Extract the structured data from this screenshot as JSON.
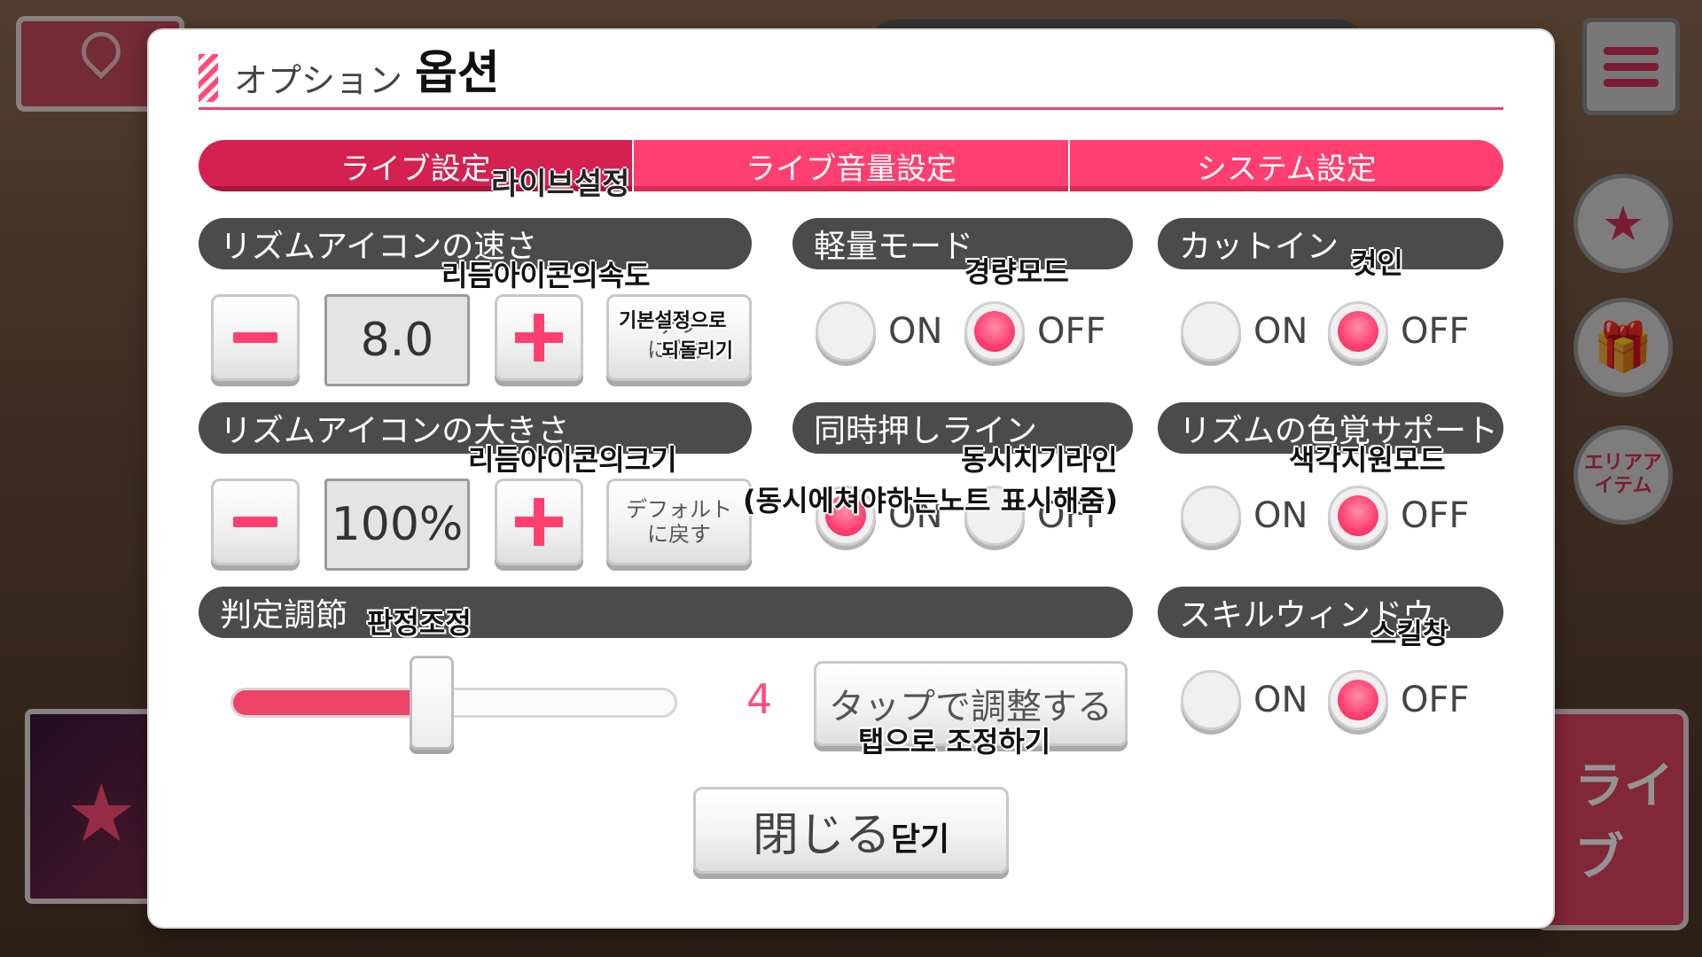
{
  "title": {
    "jp": "オプション",
    "kr": "옵션"
  },
  "tabs": [
    {
      "label": "ライブ設定",
      "active": true
    },
    {
      "label": "ライブ音量設定",
      "active": false
    },
    {
      "label": "システム設定",
      "active": false
    }
  ],
  "tab_translation": "라이브설정",
  "speed": {
    "header": "リズムアイコンの速さ",
    "translation": "리듬아이콘의속도",
    "value": "8.0",
    "reset_line1": "デフ",
    "reset_line2": "に戻す",
    "reset_translation1": "기본설정으로",
    "reset_translation2": "되돌리기"
  },
  "size": {
    "header": "リズムアイコンの大きさ",
    "translation": "리듬아이콘의크기",
    "value": "100%",
    "reset_line1": "デフォルト",
    "reset_line2": "に戻す"
  },
  "light_mode": {
    "header": "軽量モード",
    "translation": "경량모드",
    "on": "ON",
    "off": "OFF",
    "selected": "OFF"
  },
  "cut_in": {
    "header": "カットイン",
    "translation": "컷인",
    "on": "ON",
    "off": "OFF",
    "selected": "OFF"
  },
  "sync_line": {
    "header": "同時押しライン",
    "translation": "동시치기라인",
    "translation2": "(동시에쳐야하는노트 표시해줌)",
    "on": "ON",
    "off": "OFF",
    "selected": "ON"
  },
  "color_support": {
    "header": "リズムの色覚サポート",
    "translation": "색각지원모드",
    "on": "ON",
    "off": "OFF",
    "selected": "OFF"
  },
  "judgement": {
    "header": "判定調節",
    "translation": "판정조정",
    "value": "4",
    "fraction": 0.45,
    "tap_label": "タップで調整する",
    "tap_translation": "탭으로 조정하기"
  },
  "skill_window": {
    "header": "スキルウィンドウ",
    "translation": "스킬창",
    "on": "ON",
    "off": "OFF",
    "selected": "OFF"
  },
  "close": {
    "label": "閉じる",
    "translation": "닫기"
  },
  "background": {
    "area_item": "エリアアイテム",
    "live": "ライブ"
  },
  "colors": {
    "accent": "#ff3f70",
    "header_bg": "#4b4b4b",
    "tab_active": "#d42151"
  }
}
